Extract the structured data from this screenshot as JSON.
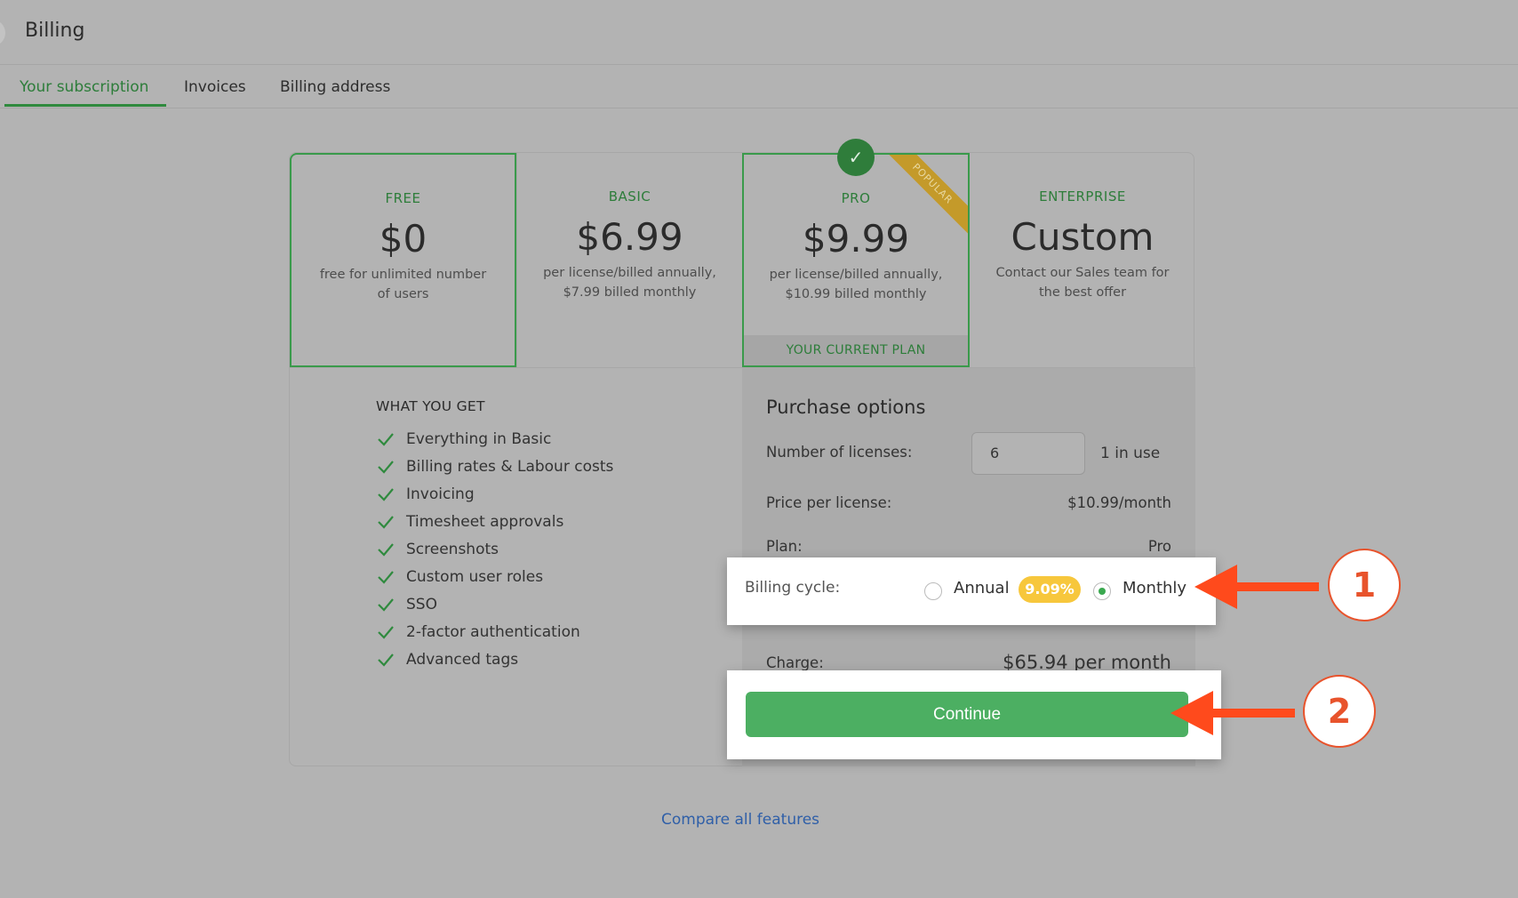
{
  "header": {
    "title": "Billing"
  },
  "tabs": [
    {
      "label": "Your subscription",
      "active": true
    },
    {
      "label": "Invoices",
      "active": false
    },
    {
      "label": "Billing address",
      "active": false
    }
  ],
  "plans": [
    {
      "name": "FREE",
      "price": "$0",
      "description": "free for unlimited number of users"
    },
    {
      "name": "BASIC",
      "price": "$6.99",
      "description": "per license/billed annually, $7.99 billed monthly"
    },
    {
      "name": "PRO",
      "price": "$9.99",
      "description": "per license/billed annually, $10.99 billed monthly",
      "badge": "POPULAR",
      "current_label": "YOUR CURRENT PLAN"
    },
    {
      "name": "ENTERPRISE",
      "price": "Custom",
      "description": "Contact our Sales team for the best offer"
    }
  ],
  "features": {
    "title": "WHAT YOU GET",
    "items": [
      "Everything in Basic",
      "Billing rates & Labour costs",
      "Invoicing",
      "Timesheet approvals",
      "Screenshots",
      "Custom user roles",
      "SSO",
      "2-factor authentication",
      "Advanced tags"
    ]
  },
  "purchase": {
    "title": "Purchase options",
    "licenses_label": "Number of licenses:",
    "licenses_value": "6",
    "in_use": "1 in use",
    "price_label": "Price per license:",
    "price_value": "$10.99/month",
    "plan_label": "Plan:",
    "plan_value": "Pro",
    "cycle_label": "Billing cycle:",
    "cycle_annual": "Annual",
    "cycle_discount": "9.09%",
    "cycle_monthly": "Monthly",
    "cycle_selected": "Monthly",
    "charge_label": "Charge:",
    "charge_value": "$65.94 per month",
    "continue_label": "Continue"
  },
  "steps": [
    "1",
    "2"
  ],
  "compare_link": "Compare all features",
  "colors": {
    "accent": "#4caf62",
    "annotation": "#e8532c",
    "discount": "#f7c73c"
  }
}
